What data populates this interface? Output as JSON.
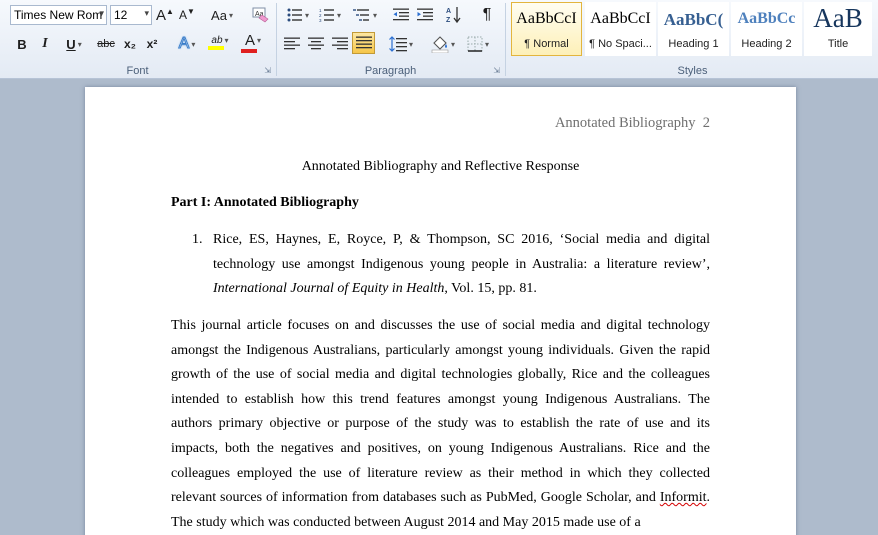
{
  "ribbon": {
    "font": {
      "label": "Font",
      "font_name": "Times New Rom",
      "font_size": "12",
      "grow_label": "A",
      "shrink_label": "A",
      "change_case_label": "Aa",
      "bold_label": "B",
      "italic_label": "I",
      "underline_label": "U",
      "strikethrough_label": "abc",
      "subscript_label": "x₂",
      "superscript_label": "x²",
      "text_effects_label": "A",
      "highlight_label": "ab",
      "font_color_label": "A",
      "highlight_color": "#ffff00",
      "font_color": "#e02020"
    },
    "paragraph": {
      "label": "Paragraph",
      "show_marks_label": "¶"
    },
    "styles": {
      "label": "Styles",
      "items": [
        {
          "sample": "AaBbCcI",
          "name": "¶ Normal"
        },
        {
          "sample": "AaBbCcI",
          "name": "¶ No Spaci..."
        },
        {
          "sample": "AaBbC(",
          "name": "Heading 1"
        },
        {
          "sample": "AaBbCc",
          "name": "Heading 2"
        },
        {
          "sample": "AaB",
          "name": "Title"
        }
      ],
      "heading_color": "#365f91",
      "heading2_color": "#4f81bd"
    }
  },
  "document": {
    "running_header": "Annotated Bibliography  2",
    "title": "Annotated Bibliography and Reflective Response",
    "section_heading": "Part I: Annotated Bibliography",
    "reference": {
      "number": "1.",
      "text_before": "Rice, ES, Haynes, E, Royce, P, & Thompson, SC 2016, ‘Social media and digital technology use amongst Indigenous young people in Australia: a literature review’, ",
      "journal": "International Journal of Equity in Health",
      "text_after": ", Vol. 15, pp. 81."
    },
    "body_before_error": "This journal article focuses on and discusses the use of social media and digital technology amongst the Indigenous Australians, particularly amongst young individuals. Given the rapid growth of the use of social media and digital technologies globally, Rice and the colleagues intended to establish how this trend features amongst young Indigenous Australians. The authors primary objective or purpose of the study was to establish the rate of use and its impacts, both the negatives and positives, on young Indigenous Australians. Rice and the colleagues employed the use of literature review as their method in which they collected relevant sources of information from databases such as PubMed, Google Scholar, and ",
    "spelling_error_word": "Informit",
    "body_after_error": ". The study which was conducted between August 2014 and May 2015 made use of a"
  }
}
